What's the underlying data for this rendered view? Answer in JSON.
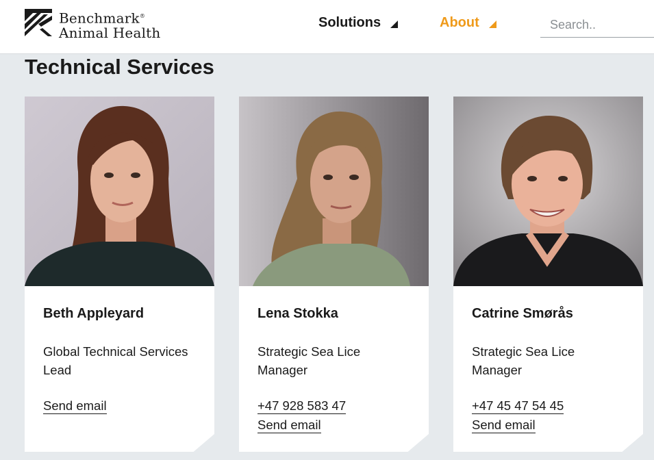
{
  "brand": {
    "name_line1": "Benchmark",
    "reg_mark": "®",
    "name_line2": "Animal Health"
  },
  "nav": {
    "solutions_label": "Solutions",
    "about_label": "About",
    "search_placeholder": "Search.."
  },
  "colors": {
    "accent": "#ef9a1a",
    "background": "#e6eaed",
    "card": "#ffffff",
    "text": "#1a1a1a"
  },
  "page": {
    "title": "Technical Services"
  },
  "people": [
    {
      "name": "Beth Appleyard",
      "role": "Global Technical Services Lead",
      "phone": "",
      "email_label": "Send email"
    },
    {
      "name": "Lena Stokka",
      "role": "Strategic Sea Lice Manager",
      "phone": "+47 928 583 47",
      "email_label": "Send email"
    },
    {
      "name": "Catrine Smørås",
      "role": "Strategic Sea Lice Manager",
      "phone": "+47 45 47 54 45",
      "email_label": "Send email"
    }
  ]
}
